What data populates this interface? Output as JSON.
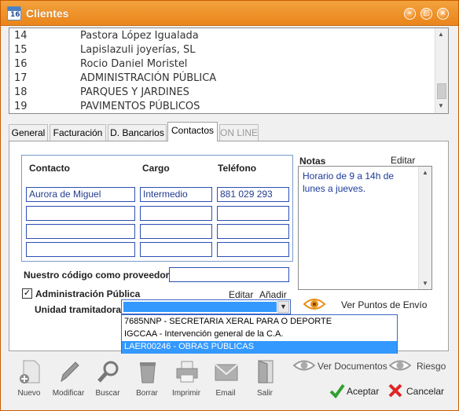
{
  "window": {
    "title": "Clientes",
    "app_icon_text": "16"
  },
  "client_list": [
    {
      "num": "14",
      "name": "Pastora López Igualada"
    },
    {
      "num": "15",
      "name": "Lapislazuli joyerías, SL"
    },
    {
      "num": "16",
      "name": "Rocio Daniel Moristel"
    },
    {
      "num": "17",
      "name": "ADMINISTRACIÓN PÚBLICA"
    },
    {
      "num": "18",
      "name": "PARQUES Y JARDINES"
    },
    {
      "num": "19",
      "name": "PAVIMENTOS PÚBLICOS"
    }
  ],
  "tabs": [
    {
      "label": "General"
    },
    {
      "label": "Facturación"
    },
    {
      "label": "D. Bancarios"
    },
    {
      "label": "Contactos",
      "active": true
    },
    {
      "label": "ON LINE",
      "disabled": true
    }
  ],
  "contacts": {
    "headers": {
      "contacto": "Contacto",
      "cargo": "Cargo",
      "telefono": "Teléfono"
    },
    "rows": [
      {
        "contacto": "Aurora de Miguel",
        "cargo": "Intermedio",
        "telefono": "881 029 293"
      },
      {
        "contacto": "",
        "cargo": "",
        "telefono": ""
      },
      {
        "contacto": "",
        "cargo": "",
        "telefono": ""
      },
      {
        "contacto": "",
        "cargo": "",
        "telefono": ""
      }
    ]
  },
  "notes": {
    "label": "Notas",
    "edit_label": "Editar",
    "text": "Horario de 9 a 14h de lunes a jueves."
  },
  "provider_code": {
    "label": "Nuestro código como proveedor",
    "value": ""
  },
  "admin": {
    "checkbox_label": "Administración Pública",
    "checked": true,
    "edit_label": "Editar",
    "add_label": "Añadir",
    "unit_label": "Unidad tramitadora",
    "unit_value": "",
    "options": [
      "7685NNP - SECRETARIA XERAL PARA O DEPORTE",
      "IGCCAA - Intervención general de la C.A.",
      "LAER00246 - OBRAS PÚBLICAS"
    ],
    "selected_option_index": 2
  },
  "links": {
    "ver_puntos_envio": "Ver Puntos de Envío",
    "ver_documentos": "Ver Documentos",
    "riesgo": "Riesgo"
  },
  "toolbar": {
    "nuevo": "Nuevo",
    "modificar": "Modificar",
    "buscar": "Buscar",
    "borrar": "Borrar",
    "imprimir": "Imprimir",
    "email": "Email",
    "salir": "Salir"
  },
  "actions": {
    "aceptar": "Aceptar",
    "cancelar": "Cancelar"
  },
  "colors": {
    "title_bar": "#ee9020",
    "field_border": "#2d4fb5",
    "field_text": "#233b8f",
    "selection": "#3399ff"
  }
}
